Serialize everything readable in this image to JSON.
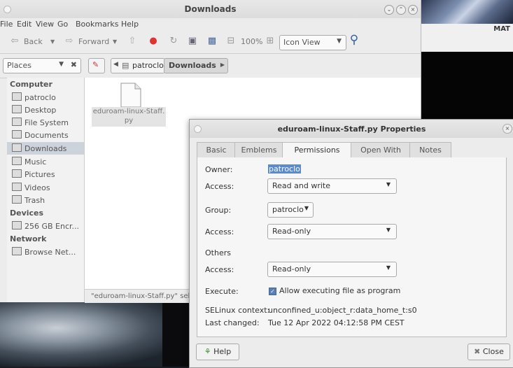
{
  "desktop": {
    "right_window_title": "MAT"
  },
  "file_manager": {
    "title": "Downloads",
    "menu": [
      "File",
      "Edit",
      "View",
      "Go",
      "Bookmarks",
      "Help"
    ],
    "toolbar": {
      "back": "Back",
      "forward": "Forward",
      "zoom": "100%",
      "view_mode": "Icon View"
    },
    "location": {
      "places": "Places",
      "path": [
        "patroclo",
        "Downloads"
      ]
    },
    "sidebar": {
      "sections": [
        "Computer",
        "Devices",
        "Network"
      ],
      "computer_items": [
        "patroclo",
        "Desktop",
        "File System",
        "Documents",
        "Downloads",
        "Music",
        "Pictures",
        "Videos",
        "Trash"
      ],
      "device_items": [
        "256 GB Encr..."
      ],
      "network_items": [
        "Browse Net..."
      ],
      "selected": "Downloads"
    },
    "file": {
      "name_line1": "eduroam-linux-Staff.",
      "name_line2": "py"
    },
    "status": "\"eduroam-linux-Staff.py\" sel"
  },
  "dialog": {
    "title": "eduroam-linux-Staff.py Properties",
    "tabs": [
      "Basic",
      "Emblems",
      "Permissions",
      "Open With",
      "Notes"
    ],
    "active_tab": "Permissions",
    "owner_label": "Owner:",
    "owner_value": "patroclo",
    "owner_access_label": "Access:",
    "owner_access": "Read and write",
    "group_label": "Group:",
    "group_value": "patroclo",
    "group_access_label": "Access:",
    "group_access": "Read-only",
    "others_label": "Others",
    "others_access_label": "Access:",
    "others_access": "Read-only",
    "execute_label": "Execute:",
    "execute_text": "Allow executing file as program",
    "selinux_label": "SELinux context:",
    "selinux_value": "unconfined_u:object_r:data_home_t:s0",
    "changed_label": "Last changed:",
    "changed_value": "Tue 12 Apr 2022 04:12:58 PM CEST",
    "help_button": "Help",
    "close_button": "Close"
  },
  "colors": {
    "selection": "#5a7fb5",
    "sidebar_selected": "#cdd3da",
    "search_icon": "#2f5f9e"
  }
}
